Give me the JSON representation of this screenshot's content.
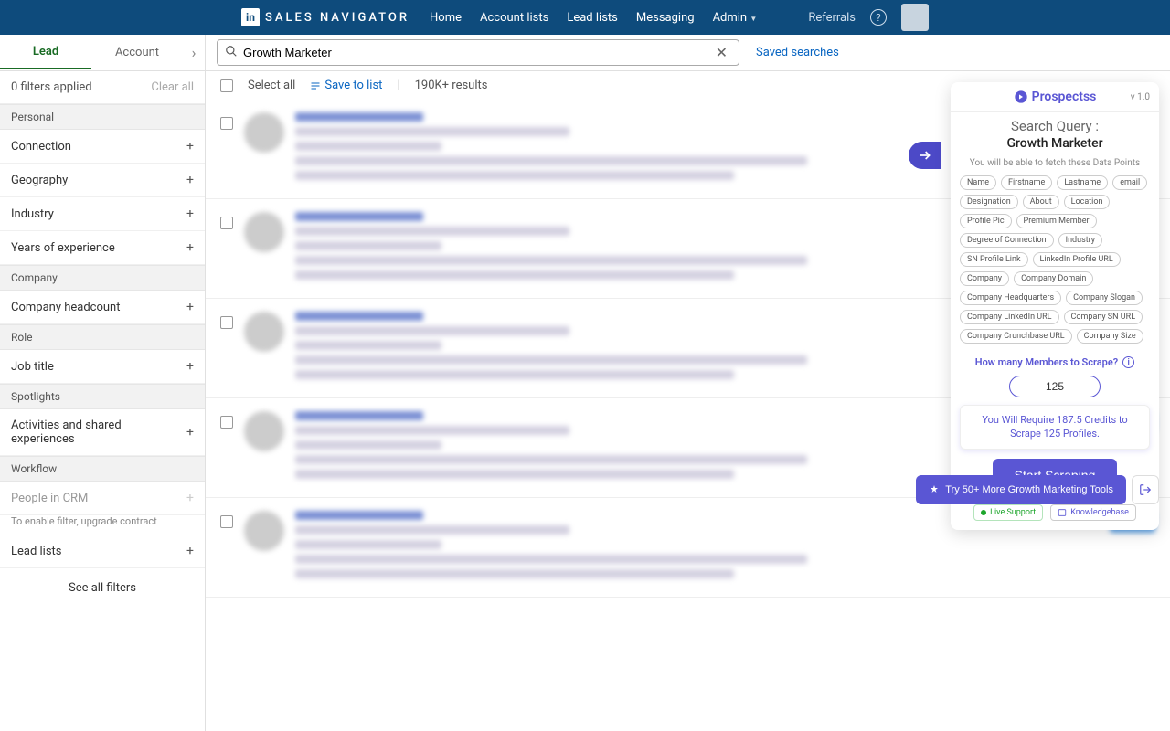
{
  "topbar": {
    "badge": "in",
    "brand": "SALES NAVIGATOR",
    "links": [
      "Home",
      "Account lists",
      "Lead lists",
      "Messaging",
      "Admin"
    ],
    "referrals": "Referrals",
    "help": "?"
  },
  "tabs": {
    "lead": "Lead",
    "account": "Account"
  },
  "search": {
    "value": "Growth Marketer"
  },
  "saved_searches": "Saved searches",
  "filters_applied": "0 filters applied",
  "clear_all": "Clear all",
  "sections": {
    "personal": {
      "head": "Personal",
      "items": [
        "Connection",
        "Geography",
        "Industry",
        "Years of experience"
      ]
    },
    "company": {
      "head": "Company",
      "items": [
        "Company headcount"
      ]
    },
    "role": {
      "head": "Role",
      "items": [
        "Job title"
      ]
    },
    "spotlights": {
      "head": "Spotlights",
      "items": [
        "Activities and shared experiences"
      ]
    },
    "workflow": {
      "head": "Workflow",
      "crm": "People in CRM",
      "crm_note": "To enable filter, upgrade contract",
      "leadlists": "Lead lists"
    }
  },
  "see_all": "See all filters",
  "actions": {
    "select_all": "Select all",
    "save_list": "Save to list",
    "results": "190K+ results"
  },
  "panel": {
    "brand": "Prospectss",
    "version": "v 1.0",
    "query_label": "Search Query :",
    "query_value": "Growth Marketer",
    "fetch_note": "You will be able to fetch these Data Points",
    "pills": [
      "Name",
      "Firstname",
      "Lastname",
      "email",
      "Designation",
      "About",
      "Location",
      "Profile Pic",
      "Premium Member",
      "Degree of Connection",
      "Industry",
      "SN Profile Link",
      "LinkedIn Profile URL",
      "Company",
      "Company Domain",
      "Company Headquarters",
      "Company Slogan",
      "Company LinkedIn URL",
      "Company SN URL",
      "Company Crunchbase URL",
      "Company Size"
    ],
    "howmany": "How many Members to Scrape?",
    "count": "125",
    "credit_text": "You Will Require 187.5 Credits to Scrape 125 Profiles.",
    "start": "Start Scraping",
    "live_support": "Live Support",
    "knowledgebase": "Knowledgebase",
    "try_more": "Try 50+ More Growth Marketing Tools"
  }
}
